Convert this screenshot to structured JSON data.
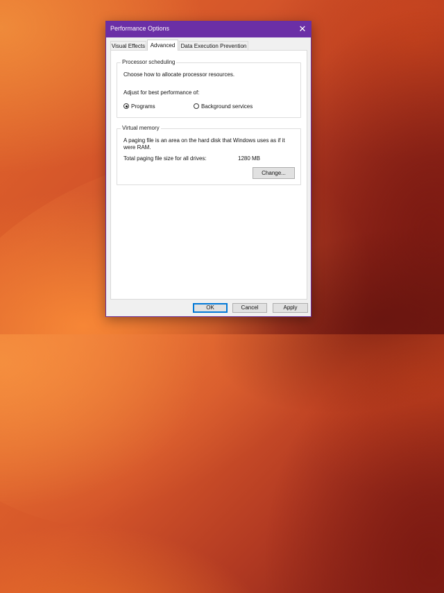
{
  "dialog": {
    "title": "Performance Options",
    "close_glyph": "✕"
  },
  "tabs": [
    {
      "label": "Visual Effects",
      "active": false
    },
    {
      "label": "Advanced",
      "active": true
    },
    {
      "label": "Data Execution Prevention",
      "active": false
    }
  ],
  "processor_scheduling": {
    "title": "Processor scheduling",
    "description": "Choose how to allocate processor resources.",
    "adjust_label": "Adjust for best performance of:",
    "options": [
      {
        "label": "Programs",
        "selected": true
      },
      {
        "label": "Background services",
        "selected": false
      }
    ]
  },
  "virtual_memory": {
    "title": "Virtual memory",
    "description_line1": "A paging file is an area on the hard disk that Windows uses as if it",
    "description_line2": "were RAM.",
    "total_label": "Total paging file size for all drives:",
    "total_value": "1280 MB",
    "change_button": "Change..."
  },
  "footer": {
    "ok": "OK",
    "cancel": "Cancel",
    "apply": "Apply"
  }
}
